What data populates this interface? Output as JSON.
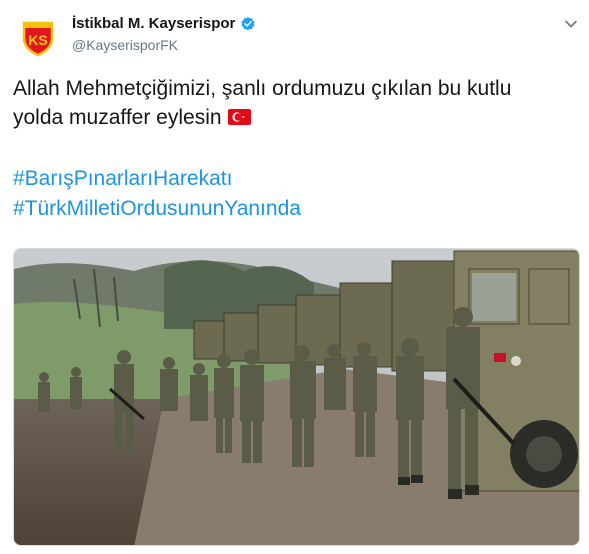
{
  "account": {
    "display_name": "İstikbal M. Kayserispor",
    "handle": "@KayserisporFK",
    "avatar_icon": "kayserispor-crest-icon",
    "verified_icon": "verified-badge-icon",
    "verified_color": "#1da1f2"
  },
  "menu": {
    "icon": "chevron-down-icon"
  },
  "tweet": {
    "line1": "Allah Mehmetçiğimizi, şanlı ordumuzu çıkılan bu kutlu",
    "line2": "yolda muzaffer eylesin",
    "flag_icon": "turkey-flag-icon",
    "hashtags": [
      "#BarışPınarlarıHarekatı",
      "#TürkMilletiOrdusununYanında"
    ],
    "hashtag_color": "#1b95e0"
  },
  "media": {
    "type": "photo",
    "subject": "soldiers-marching-column-icon"
  }
}
